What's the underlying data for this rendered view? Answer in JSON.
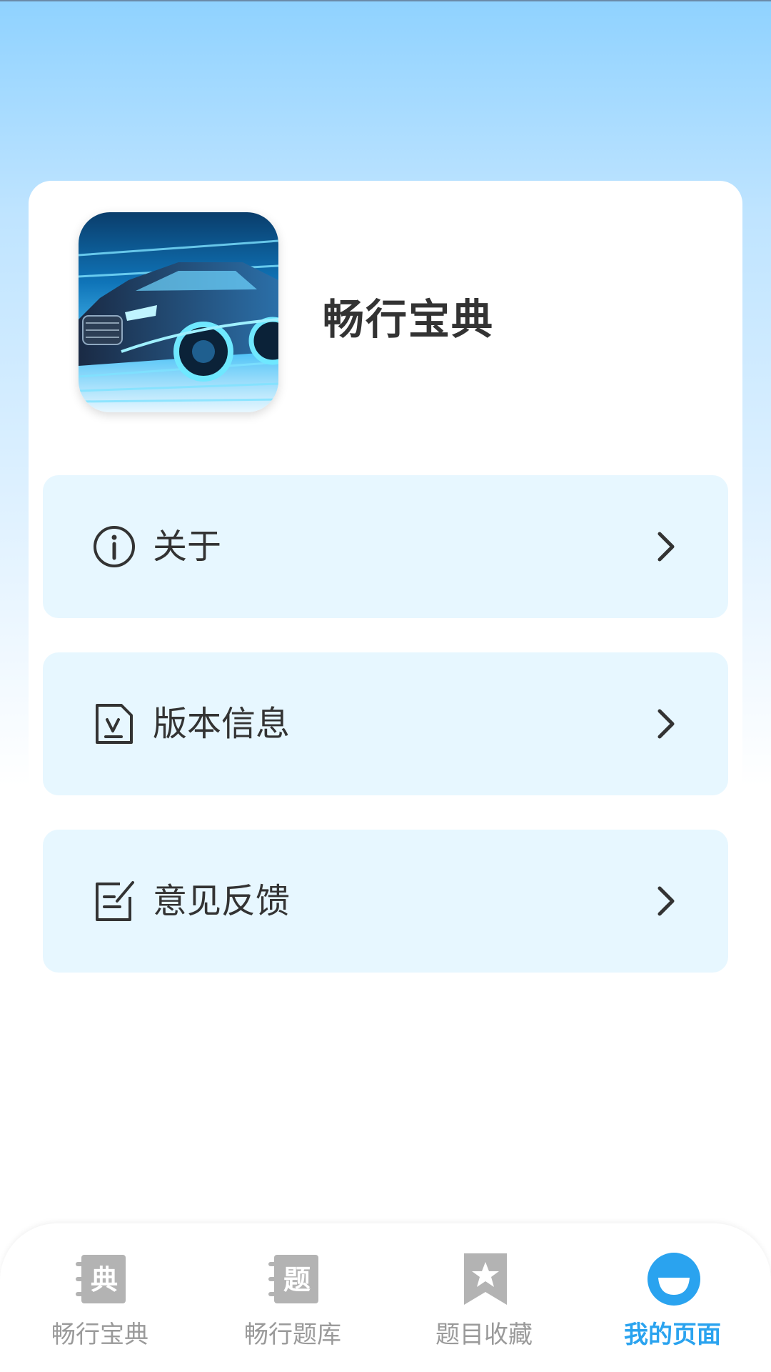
{
  "app": {
    "name": "畅行宝典"
  },
  "menu": {
    "items": [
      {
        "label": "关于",
        "icon": "info-circle-icon"
      },
      {
        "label": "版本信息",
        "icon": "version-document-icon"
      },
      {
        "label": "意见反馈",
        "icon": "feedback-edit-icon"
      }
    ]
  },
  "tabbar": {
    "tabs": [
      {
        "label": "畅行宝典",
        "icon": "handbook-icon",
        "active": false
      },
      {
        "label": "畅行题库",
        "icon": "question-bank-icon",
        "active": false
      },
      {
        "label": "题目收藏",
        "icon": "bookmark-star-icon",
        "active": false
      },
      {
        "label": "我的页面",
        "icon": "smile-profile-icon",
        "active": true
      }
    ]
  },
  "colors": {
    "accent": "#2aa3ef",
    "menu_bg": "#e7f7ff",
    "inactive": "#9a9a9a",
    "text": "#333333"
  }
}
